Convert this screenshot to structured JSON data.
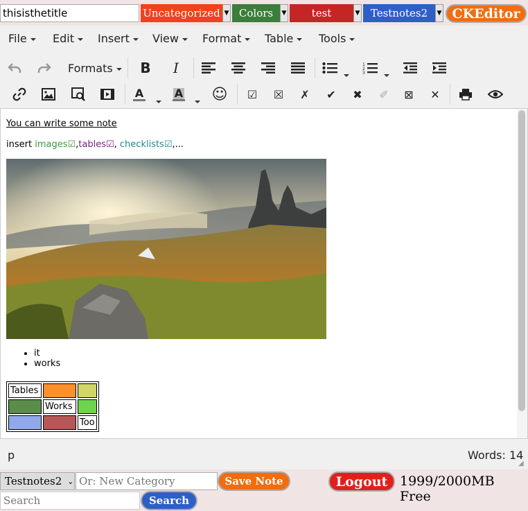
{
  "top_bar": {
    "title_value": "thisisthetitle",
    "categories": [
      {
        "label": "Uncategorized",
        "color": "#f0421c"
      },
      {
        "label": "Colors",
        "color": "#3b7d3b"
      },
      {
        "label": "test",
        "color": "#c42525"
      },
      {
        "label": "Testnotes2",
        "color": "#2e5fc7"
      }
    ],
    "editor_button": "CKEditor"
  },
  "menubar": [
    "File",
    "Edit",
    "Insert",
    "View",
    "Format",
    "Table",
    "Tools"
  ],
  "toolbar": {
    "formats_label": "Formats",
    "row1_icons": [
      "undo-icon",
      "redo-icon",
      "bold-icon",
      "italic-icon",
      "align-left-icon",
      "align-center-icon",
      "align-right-icon",
      "align-justify-icon",
      "bullet-list-icon",
      "numbered-list-icon",
      "outdent-icon",
      "indent-icon"
    ],
    "row2_icons": [
      "link-icon",
      "image-icon",
      "media-search-icon",
      "video-icon",
      "text-color-icon",
      "background-color-icon",
      "emoticon-icon",
      "checkbox-checked-icon",
      "checkbox-crossed-icon",
      "cross-icon",
      "check-icon",
      "heavy-cross-icon",
      "light-check-icon",
      "boxed-x-icon",
      "close-icon",
      "print-icon",
      "preview-icon"
    ]
  },
  "content": {
    "heading": "You can write some note",
    "line2_prefix": "insert ",
    "line2_images": "images☑",
    "line2_comma1": ",",
    "line2_tables": "tables☑",
    "line2_comma2": ", ",
    "line2_checklists": "checklists☑",
    "line2_suffix": ",...",
    "list": [
      "it",
      "works"
    ],
    "table": [
      [
        {
          "text": "Tables",
          "bg": "#ffffff"
        },
        {
          "text": "",
          "bg": "#fe8f2d"
        },
        {
          "text": "",
          "bg": "#d1d56a"
        }
      ],
      [
        {
          "text": "",
          "bg": "#5a8d4a"
        },
        {
          "text": "Works",
          "bg": "#ffffff"
        },
        {
          "text": "",
          "bg": "#6fd34e"
        }
      ],
      [
        {
          "text": "",
          "bg": "#91a8ea"
        },
        {
          "text": "",
          "bg": "#b65858"
        },
        {
          "text": "Too",
          "bg": "#ffffff"
        }
      ]
    ],
    "colors": {
      "images": "#3a9a3a",
      "tables": "#7a1f8a",
      "checklists": "#1e8a8a"
    }
  },
  "statusbar": {
    "path": "p",
    "word_count": "Words: 14"
  },
  "bottom": {
    "category_selected": "Testnotes2",
    "new_category_placeholder": "Or: New Category",
    "save_button": "Save Note",
    "logout_button": "Logout",
    "storage_text": "1999/2000MB Free",
    "search_placeholder": "Search",
    "search_button": "Search"
  }
}
